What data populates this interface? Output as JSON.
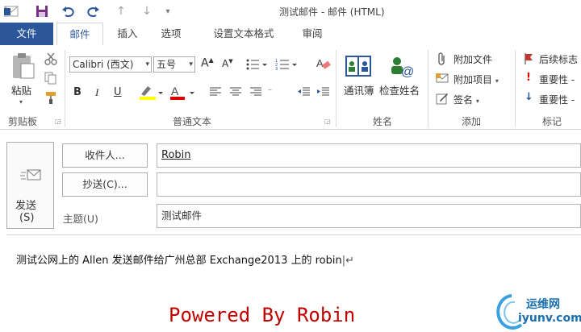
{
  "window": {
    "title": "测试邮件   - 邮件 (HTML)"
  },
  "quick_access": {
    "icons": [
      "save-icon",
      "undo-icon",
      "redo-icon",
      "up-arrow-icon",
      "down-arrow-icon",
      "customize-icon"
    ]
  },
  "tabs": [
    {
      "label": "文件"
    },
    {
      "label": "邮件"
    },
    {
      "label": "插入"
    },
    {
      "label": "选项"
    },
    {
      "label": "设置文本格式"
    },
    {
      "label": "审阅"
    }
  ],
  "ribbon": {
    "clipboard": {
      "paste_label": "粘贴",
      "group_label": "剪贴板"
    },
    "basic_text": {
      "font_name": "Calibri (西文)",
      "font_size": "五号",
      "bold": "B",
      "italic": "I",
      "underline": "U",
      "grow": "A",
      "shrink": "A",
      "group_label": "普通文本"
    },
    "names": {
      "address_book": "通讯簿",
      "check_names": "检查姓名",
      "group_label": "姓名"
    },
    "include": {
      "attach_file": "附加文件",
      "attach_item": "附加项目",
      "signature": "签名",
      "group_label": "添加"
    },
    "tags": {
      "follow_up": "后续标志",
      "high_importance": "重要性 -",
      "low_importance": "重要性 -",
      "group_label": "标记"
    }
  },
  "compose": {
    "send_label_1": "发送",
    "send_label_2": "(S)",
    "to_button": "收件人...",
    "cc_button": "抄送(C)...",
    "subject_label": "主题(U)",
    "to_value": "Robin",
    "cc_value": "",
    "subject_value": "测试邮件",
    "body_text": "测试公网上的 Allen  发送邮件给广州总部 Exchange2013 上的 robin",
    "watermark": "Powered By Robin",
    "logo_cn": "运维网",
    "logo_en": "iyunv.com"
  },
  "colors": {
    "accent": "#2b579a",
    "watermark": "#c00000",
    "highlight": "#ffff00",
    "font_color": "#e00000",
    "flag": "#c0392b"
  }
}
